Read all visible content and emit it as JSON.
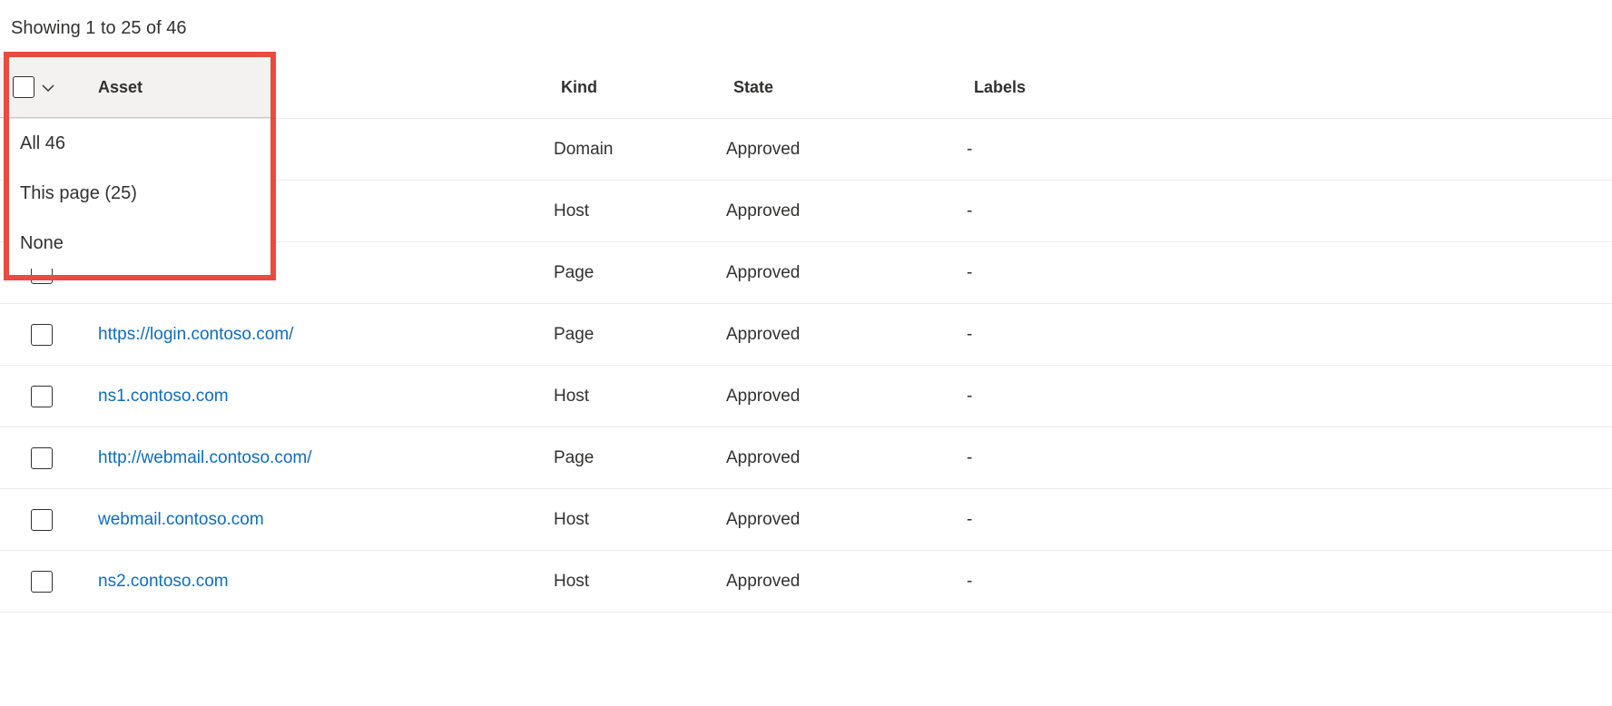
{
  "pagination": {
    "showing_text": "Showing 1 to 25 of 46"
  },
  "columns": {
    "asset": "Asset",
    "kind": "Kind",
    "state": "State",
    "labels": "Labels"
  },
  "dropdown": {
    "items": [
      {
        "label": "All 46"
      },
      {
        "label": "This page (25)"
      },
      {
        "label": "None"
      }
    ]
  },
  "rows": [
    {
      "asset": "",
      "kind": "Domain",
      "state": "Approved",
      "labels": "-"
    },
    {
      "asset": "",
      "kind": "Host",
      "state": "Approved",
      "labels": "-"
    },
    {
      "asset": "",
      "kind": "Page",
      "state": "Approved",
      "labels": "-"
    },
    {
      "asset": "https://login.contoso.com/",
      "kind": "Page",
      "state": "Approved",
      "labels": "-"
    },
    {
      "asset": "ns1.contoso.com",
      "kind": "Host",
      "state": "Approved",
      "labels": "-"
    },
    {
      "asset": "http://webmail.contoso.com/",
      "kind": "Page",
      "state": "Approved",
      "labels": "-"
    },
    {
      "asset": "webmail.contoso.com",
      "kind": "Host",
      "state": "Approved",
      "labels": "-"
    },
    {
      "asset": "ns2.contoso.com",
      "kind": "Host",
      "state": "Approved",
      "labels": "-"
    }
  ]
}
